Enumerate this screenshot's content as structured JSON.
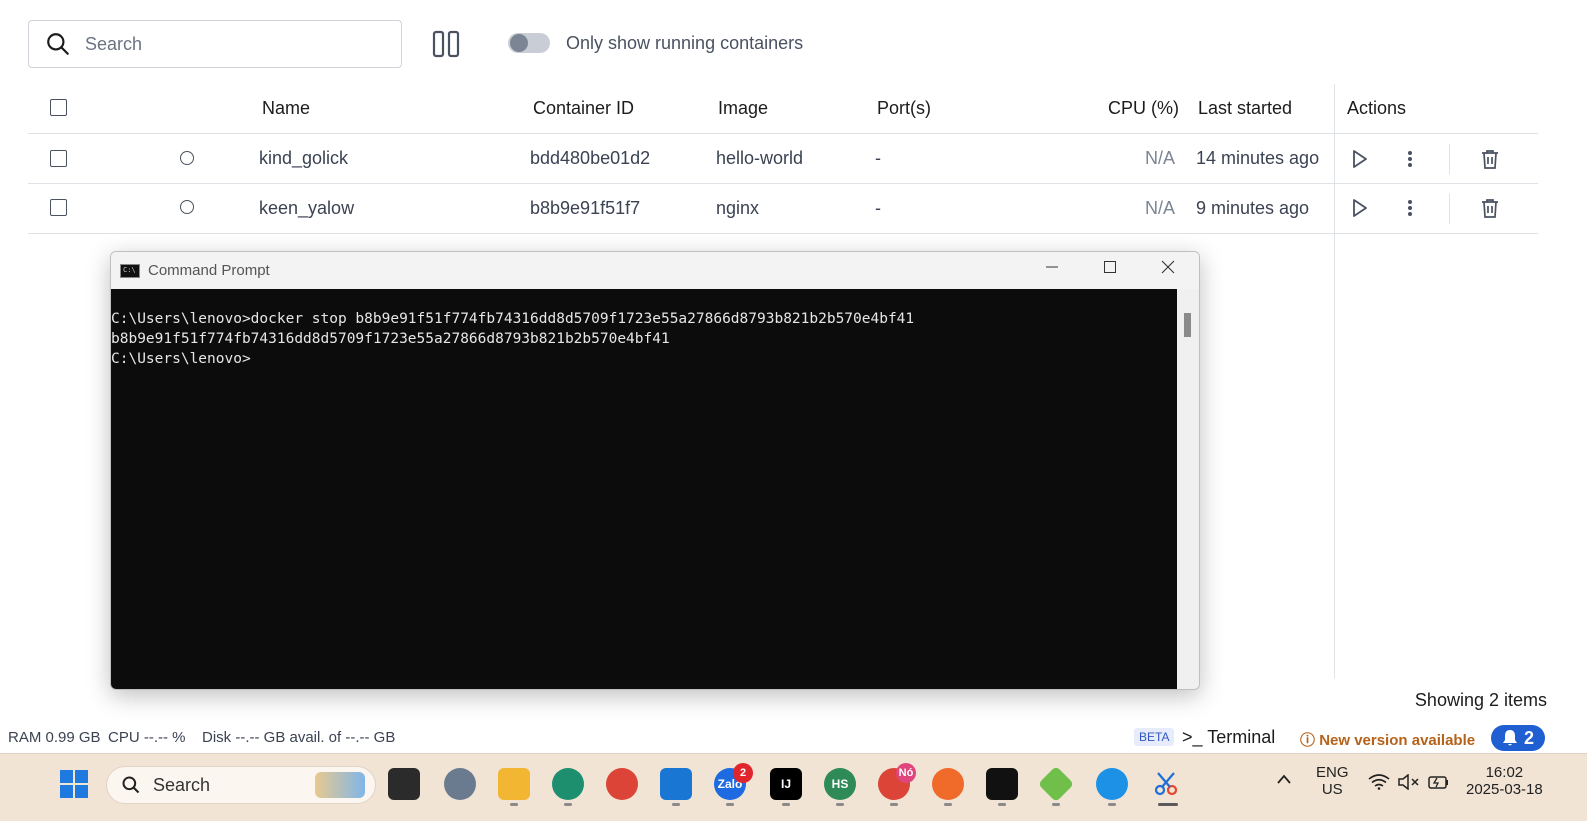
{
  "toolbar": {
    "search_placeholder": "Search",
    "toggle_label": "Only show running containers"
  },
  "table": {
    "headers": {
      "name": "Name",
      "container_id": "Container ID",
      "image": "Image",
      "ports": "Port(s)",
      "cpu": "CPU (%)",
      "last_started": "Last started",
      "actions": "Actions"
    },
    "rows": [
      {
        "name": "kind_golick",
        "container_id": "bdd480be01d2",
        "image": "hello-world",
        "ports": "-",
        "cpu": "N/A",
        "last_started": "14 minutes ago"
      },
      {
        "name": "keen_yalow",
        "container_id": "b8b9e91f51f7",
        "image": "nginx",
        "ports": "-",
        "cpu": "N/A",
        "last_started": "9 minutes ago"
      }
    ],
    "showing": "Showing 2 items"
  },
  "cmd": {
    "title": "Command Prompt",
    "icon_text": "C:\\",
    "lines": [
      "C:\\Users\\lenovo>docker stop b8b9e91f51f774fb74316dd8d5709f1723e55a27866d8793b821b2b570e4bf41",
      "b8b9e91f51f774fb74316dd8d5709f1723e55a27866d8793b821b2b570e4bf41",
      "",
      "C:\\Users\\lenovo>"
    ]
  },
  "status": {
    "ram": "RAM 0.99 GB",
    "cpu": "CPU --.-- %",
    "disk": "Disk --.-- GB avail. of --.-- GB",
    "beta": "BETA",
    "terminal": "Terminal",
    "new_version": "New version available",
    "notifications": "2"
  },
  "taskbar": {
    "search": "Search",
    "zalo_badge": "2",
    "chrome_badge": "Nó",
    "hs_label": "HS",
    "ij_label": "IJ",
    "lang": "ENG",
    "region": "US",
    "time": "16:02",
    "date": "2025-03-18"
  },
  "colors": {
    "accent": "#1f5fd1",
    "warning": "#b5621a",
    "taskbar_bg": "#f2e4d4",
    "console_bg": "#0c0c0c"
  }
}
